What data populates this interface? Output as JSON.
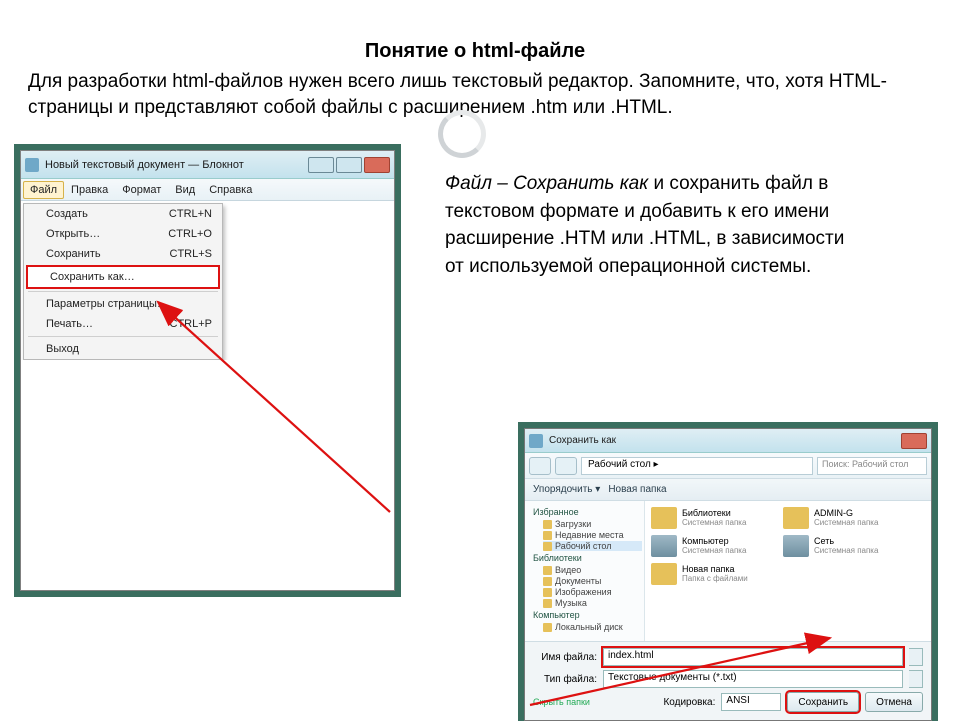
{
  "title": "Понятие о html-файле",
  "intro": "Для разработки html-файлов нужен всего лишь текстовый редактор. Запомните, что, хотя HTML-страницы и представляют собой файлы с расширением .htm или .HTML.",
  "side_first": "Файл – Сохранить как",
  "side_rest": " и сохранить файл в текстовом формате и добавить к его имени расширение .HTM или .HTML, в зависимости от используемой операционной системы.",
  "notepad": {
    "title": "Новый текстовый документ — Блокнот",
    "menu": [
      "Файл",
      "Правка",
      "Формат",
      "Вид",
      "Справка"
    ],
    "items": [
      {
        "label": "Создать",
        "short": "CTRL+N"
      },
      {
        "label": "Открыть…",
        "short": "CTRL+O"
      },
      {
        "label": "Сохранить",
        "short": "CTRL+S"
      }
    ],
    "highlight": {
      "label": "Сохранить как…",
      "short": ""
    },
    "items2": [
      {
        "label": "Параметры страницы…",
        "short": ""
      },
      {
        "label": "Печать…",
        "short": "CTRL+P"
      }
    ],
    "items3": [
      {
        "label": "Выход",
        "short": ""
      }
    ]
  },
  "save": {
    "chrome_title": "Сохранить как",
    "path": "Рабочий стол  ▸",
    "search_ph": "Поиск: Рабочий стол",
    "org": "Упорядочить ▾",
    "newf": "Новая папка",
    "side_groups": [
      {
        "name": "Избранное",
        "items": [
          "Загрузки",
          "Недавние места",
          "Рабочий стол"
        ]
      },
      {
        "name": "Библиотеки",
        "items": [
          "Видео",
          "Документы",
          "Изображения",
          "Музыка"
        ]
      },
      {
        "name": "Компьютер",
        "items": [
          "Локальный диск"
        ]
      }
    ],
    "tiles": [
      {
        "t": "Библиотеки",
        "s": "Системная папка"
      },
      {
        "t": "ADMIN-G",
        "s": "Системная папка"
      },
      {
        "t": "Компьютер",
        "s": "Системная папка",
        "pc": true
      },
      {
        "t": "Сеть",
        "s": "Системная папка"
      },
      {
        "t": "Новая папка",
        "s": "Папка с файлами"
      }
    ],
    "fname_label": "Имя файла:",
    "fname_value": "index.html",
    "ftype_label": "Тип файла:",
    "ftype_value": "Текстовые документы (*.txt)",
    "hide": "Скрыть папки",
    "enc_label": "Кодировка:",
    "enc_value": "ANSI",
    "save_btn": "Сохранить",
    "cancel_btn": "Отмена"
  }
}
